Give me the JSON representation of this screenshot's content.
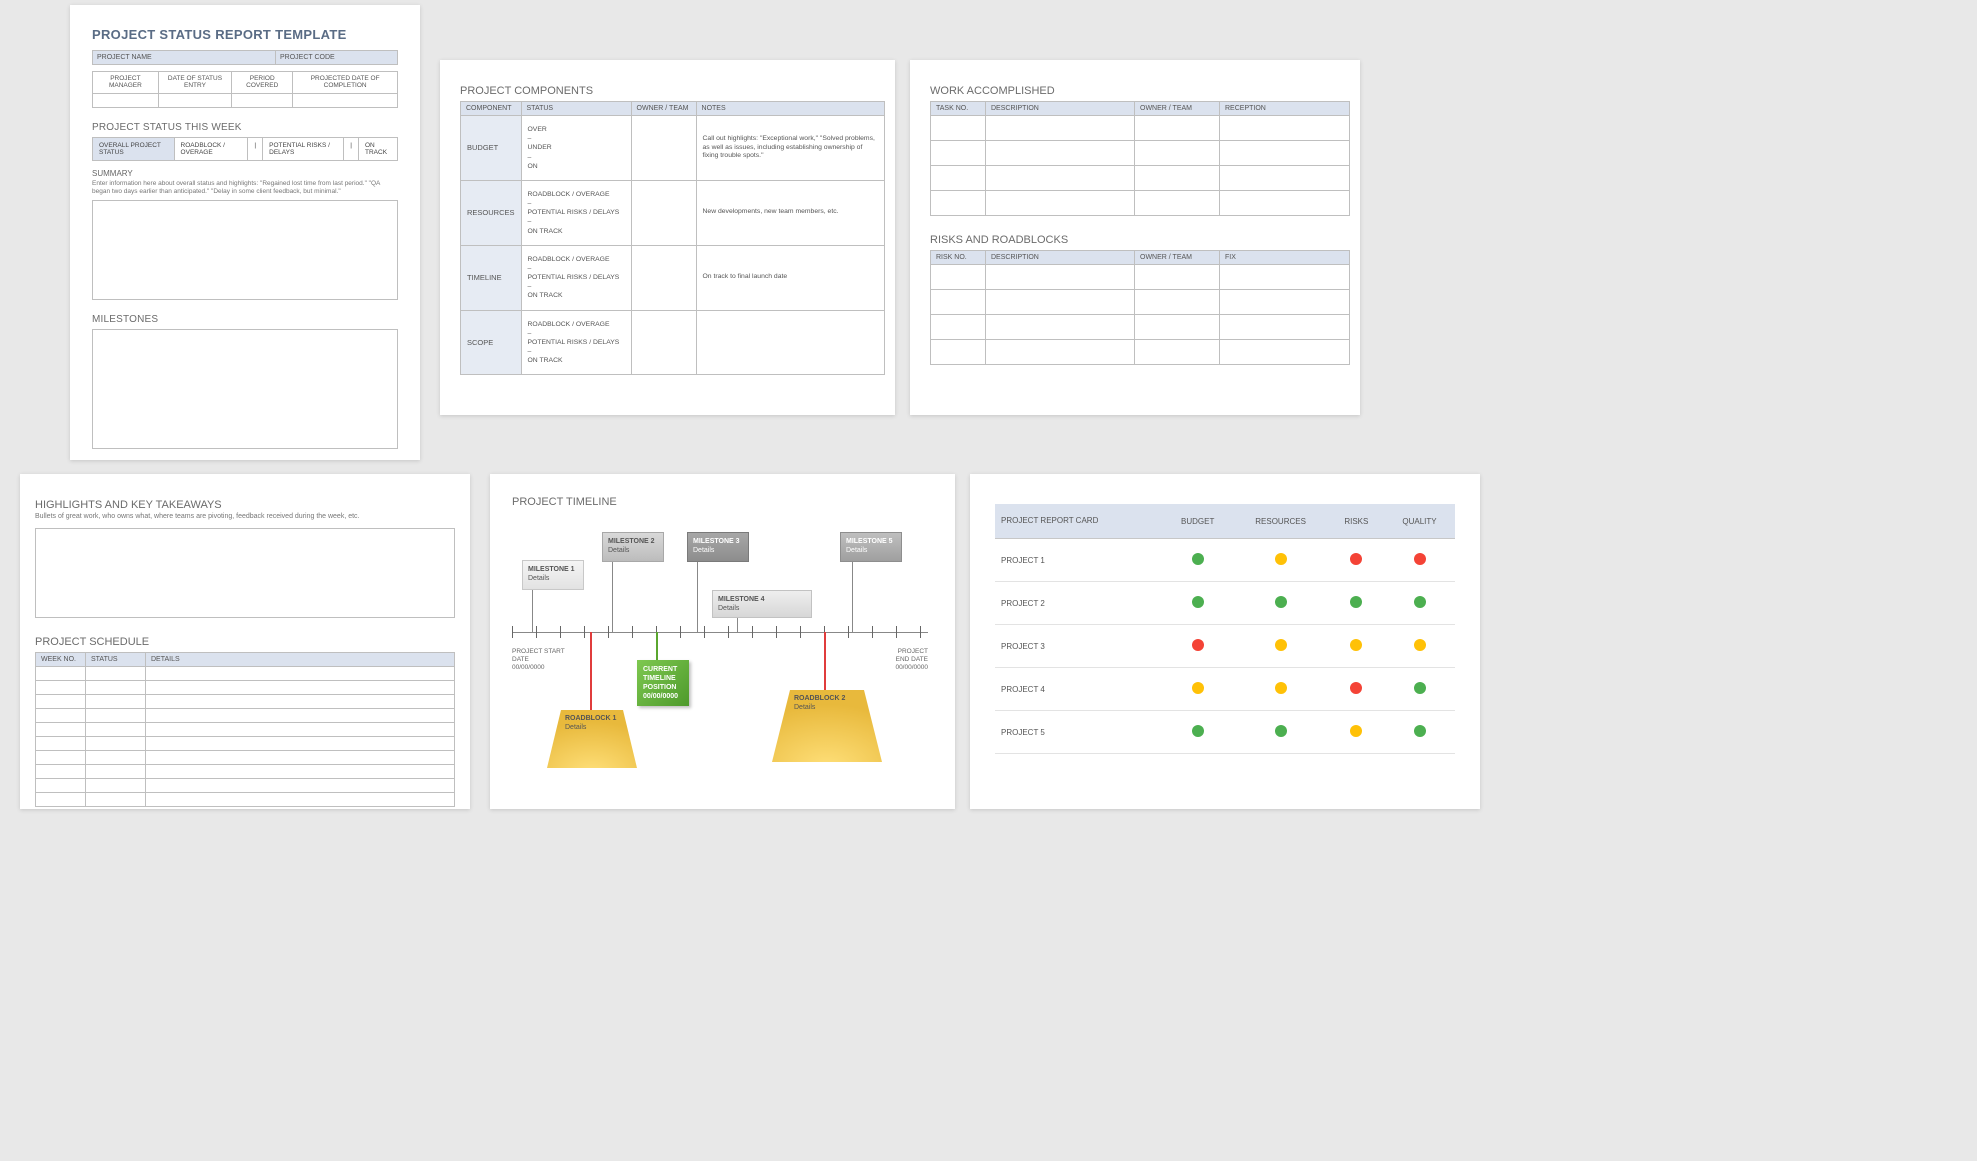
{
  "p1": {
    "title": "PROJECT STATUS REPORT TEMPLATE",
    "meta1": {
      "h1": "PROJECT NAME",
      "h2": "PROJECT CODE"
    },
    "meta2": [
      "PROJECT MANAGER",
      "DATE OF STATUS ENTRY",
      "PERIOD COVERED",
      "PROJECTED DATE OF COMPLETION"
    ],
    "status_week": "PROJECT STATUS THIS WEEK",
    "statusbar": [
      "OVERALL PROJECT STATUS",
      "ROADBLOCK / OVERAGE",
      "|",
      "POTENTIAL RISKS / DELAYS",
      "|",
      "ON TRACK"
    ],
    "summary": "SUMMARY",
    "summary_hint": "Enter information here about overall status and highlights: \"Regained lost time from last period.\" \"QA began two days earlier than anticipated.\" \"Delay in some client feedback, but minimal.\"",
    "milestones": "MILESTONES"
  },
  "p2": {
    "title": "PROJECT COMPONENTS",
    "headers": [
      "COMPONENT",
      "STATUS",
      "OWNER / TEAM",
      "NOTES"
    ],
    "rows": [
      {
        "c": "BUDGET",
        "s": "OVER\n–\nUNDER\n–\nON",
        "n": "Call out highlights: \"Exceptional work,\" \"Solved problems, as well as issues, including establishing ownership of fixing trouble spots.\""
      },
      {
        "c": "RESOURCES",
        "s": "ROADBLOCK / OVERAGE\n–\nPOTENTIAL RISKS / DELAYS\n–\nON TRACK",
        "n": "New developments, new team members, etc."
      },
      {
        "c": "TIMELINE",
        "s": "ROADBLOCK / OVERAGE\n–\nPOTENTIAL RISKS / DELAYS\n–\nON TRACK",
        "n": "On track to final launch date"
      },
      {
        "c": "SCOPE",
        "s": "ROADBLOCK / OVERAGE\n–\nPOTENTIAL RISKS / DELAYS\n–\nON TRACK",
        "n": ""
      }
    ]
  },
  "p3": {
    "t1": "WORK ACCOMPLISHED",
    "h1": [
      "TASK NO.",
      "DESCRIPTION",
      "OWNER / TEAM",
      "RECEPTION"
    ],
    "t2": "RISKS AND ROADBLOCKS",
    "h2": [
      "RISK NO.",
      "DESCRIPTION",
      "OWNER / TEAM",
      "FIX"
    ]
  },
  "p4": {
    "t1": "HIGHLIGHTS AND KEY TAKEAWAYS",
    "hint": "Bullets of great work, who owns what, where teams are pivoting, feedback received during the week, etc.",
    "t2": "PROJECT SCHEDULE",
    "h": [
      "WEEK NO.",
      "STATUS",
      "DETAILS"
    ]
  },
  "p5": {
    "title": "PROJECT TIMELINE",
    "milestones": [
      {
        "label": "MILESTONE 1",
        "sub": "Details"
      },
      {
        "label": "MILESTONE 2",
        "sub": "Details"
      },
      {
        "label": "MILESTONE 3",
        "sub": "Details"
      },
      {
        "label": "MILESTONE 4",
        "sub": "Details"
      },
      {
        "label": "MILESTONE 5",
        "sub": "Details"
      }
    ],
    "start": {
      "l1": "PROJECT START",
      "l2": "DATE",
      "l3": "00/00/0000"
    },
    "end": {
      "l1": "PROJECT",
      "l2": "END DATE",
      "l3": "00/00/0000"
    },
    "current": {
      "l1": "CURRENT",
      "l2": "TIMELINE",
      "l3": "POSITION",
      "l4": "00/00/0000"
    },
    "roadblocks": [
      {
        "l": "ROADBLOCK 1",
        "s": "Details"
      },
      {
        "l": "ROADBLOCK 2",
        "s": "Details"
      }
    ]
  },
  "p6": {
    "headers": [
      "PROJECT REPORT CARD",
      "BUDGET",
      "RESOURCES",
      "RISKS",
      "QUALITY"
    ],
    "rows": [
      {
        "name": "PROJECT 1",
        "dots": [
          "g",
          "y",
          "r",
          "r"
        ]
      },
      {
        "name": "PROJECT 2",
        "dots": [
          "g",
          "g",
          "g",
          "g"
        ]
      },
      {
        "name": "PROJECT 3",
        "dots": [
          "r",
          "y",
          "y",
          "y"
        ]
      },
      {
        "name": "PROJECT 4",
        "dots": [
          "y",
          "y",
          "r",
          "g"
        ]
      },
      {
        "name": "PROJECT 5",
        "dots": [
          "g",
          "g",
          "y",
          "g"
        ]
      }
    ]
  }
}
